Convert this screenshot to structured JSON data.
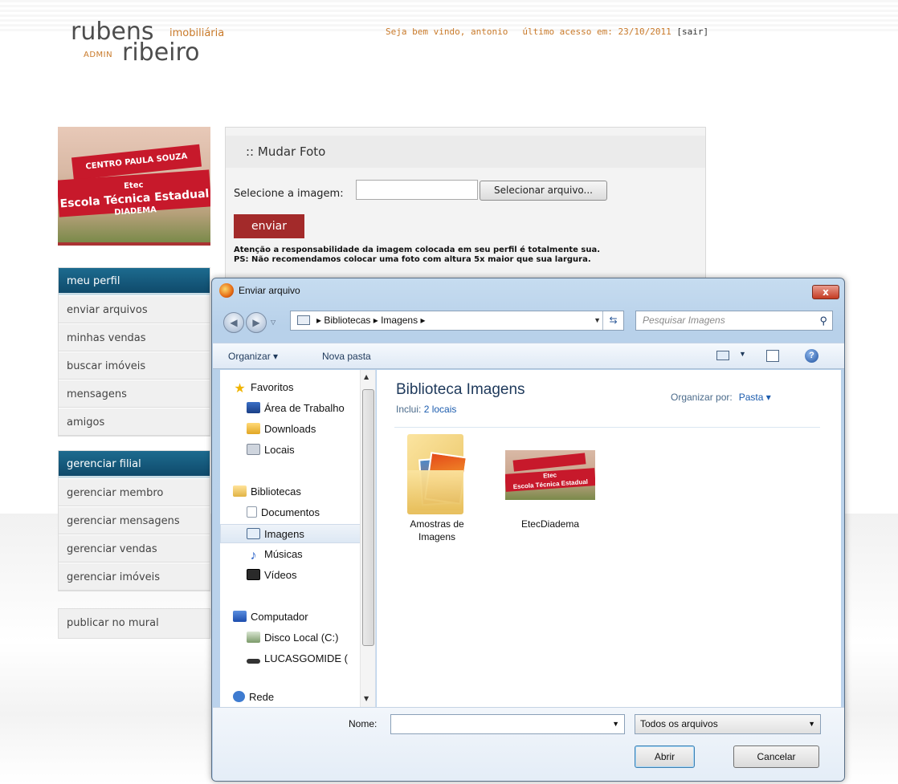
{
  "site": {
    "logo_word1": "rubens",
    "logo_word2": "imobiliária",
    "logo_word3": "ADMIN",
    "logo_word4": "ribeiro",
    "welcome": "Seja bem vindo, antonio",
    "last_access": "último acesso em: 23/10/2011",
    "logout": "[sair]",
    "photo_banner_top": "CENTRO PAULA SOUZA",
    "photo_banner_line1": "Etec",
    "photo_banner_line2": "Escola Técnica Estadual",
    "photo_banner_line3": "DIADEMA"
  },
  "sidebar": {
    "section1": {
      "title": "meu perfil",
      "items": [
        "enviar arquivos",
        "minhas vendas",
        "buscar imóveis",
        "mensagens",
        "amigos"
      ]
    },
    "section2": {
      "title": "gerenciar filial",
      "items": [
        "gerenciar membro",
        "gerenciar mensagens",
        "gerenciar vendas",
        "gerenciar imóveis"
      ]
    },
    "section3": {
      "items": [
        "publicar no mural"
      ]
    }
  },
  "panel": {
    "title": ":: Mudar Foto",
    "select_label": "Selecione a imagem:",
    "file_button": "Selecionar arquivo...",
    "send_button": "enviar",
    "note_line1": "Atenção a responsabilidade da imagem colocada em seu perfil é totalmente sua.",
    "note_line2": "PS: Não recomendamos colocar uma foto com altura 5x maior que sua largura."
  },
  "dialog": {
    "title": "Enviar arquivo",
    "close_label": "x",
    "address": "▸ Bibliotecas ▸ Imagens ▸",
    "search_placeholder": "Pesquisar Imagens",
    "toolbar_organize": "Organizar ▾",
    "toolbar_new_folder": "Nova pasta",
    "tree": {
      "favorites": "Favoritos",
      "desktop": "Área de Trabalho",
      "downloads": "Downloads",
      "locais": "Locais",
      "libraries": "Bibliotecas",
      "documents": "Documentos",
      "images": "Imagens",
      "music": "Músicas",
      "videos": "Vídeos",
      "computer": "Computador",
      "disk": "Disco Local (C:)",
      "usb": "LUCASGOMIDE (",
      "network": "Rede"
    },
    "library_title": "Biblioteca Imagens",
    "includes_label": "Inclui:",
    "includes_link": "2 locais",
    "sort_label": "Organizar por:",
    "sort_value": "Pasta ▾",
    "files": [
      {
        "name": "Amostras de Imagens",
        "icon": "folder-icon"
      },
      {
        "name": "EtecDiadema",
        "icon": "image-thumbnail"
      }
    ],
    "thumb_banner_top": "CENTRO PAULA SOUZA",
    "thumb_banner_line1": "Etec",
    "thumb_banner_line2": "Escola Técnica Estadual",
    "name_label": "Nome:",
    "name_value": "",
    "file_type": "Todos os arquivos",
    "open_button": "Abrir",
    "cancel_button": "Cancelar"
  },
  "colors": {
    "accent_orange": "#c97a2a",
    "menu_header_blue": "#0f4a6b",
    "send_red": "#a32a2a"
  }
}
